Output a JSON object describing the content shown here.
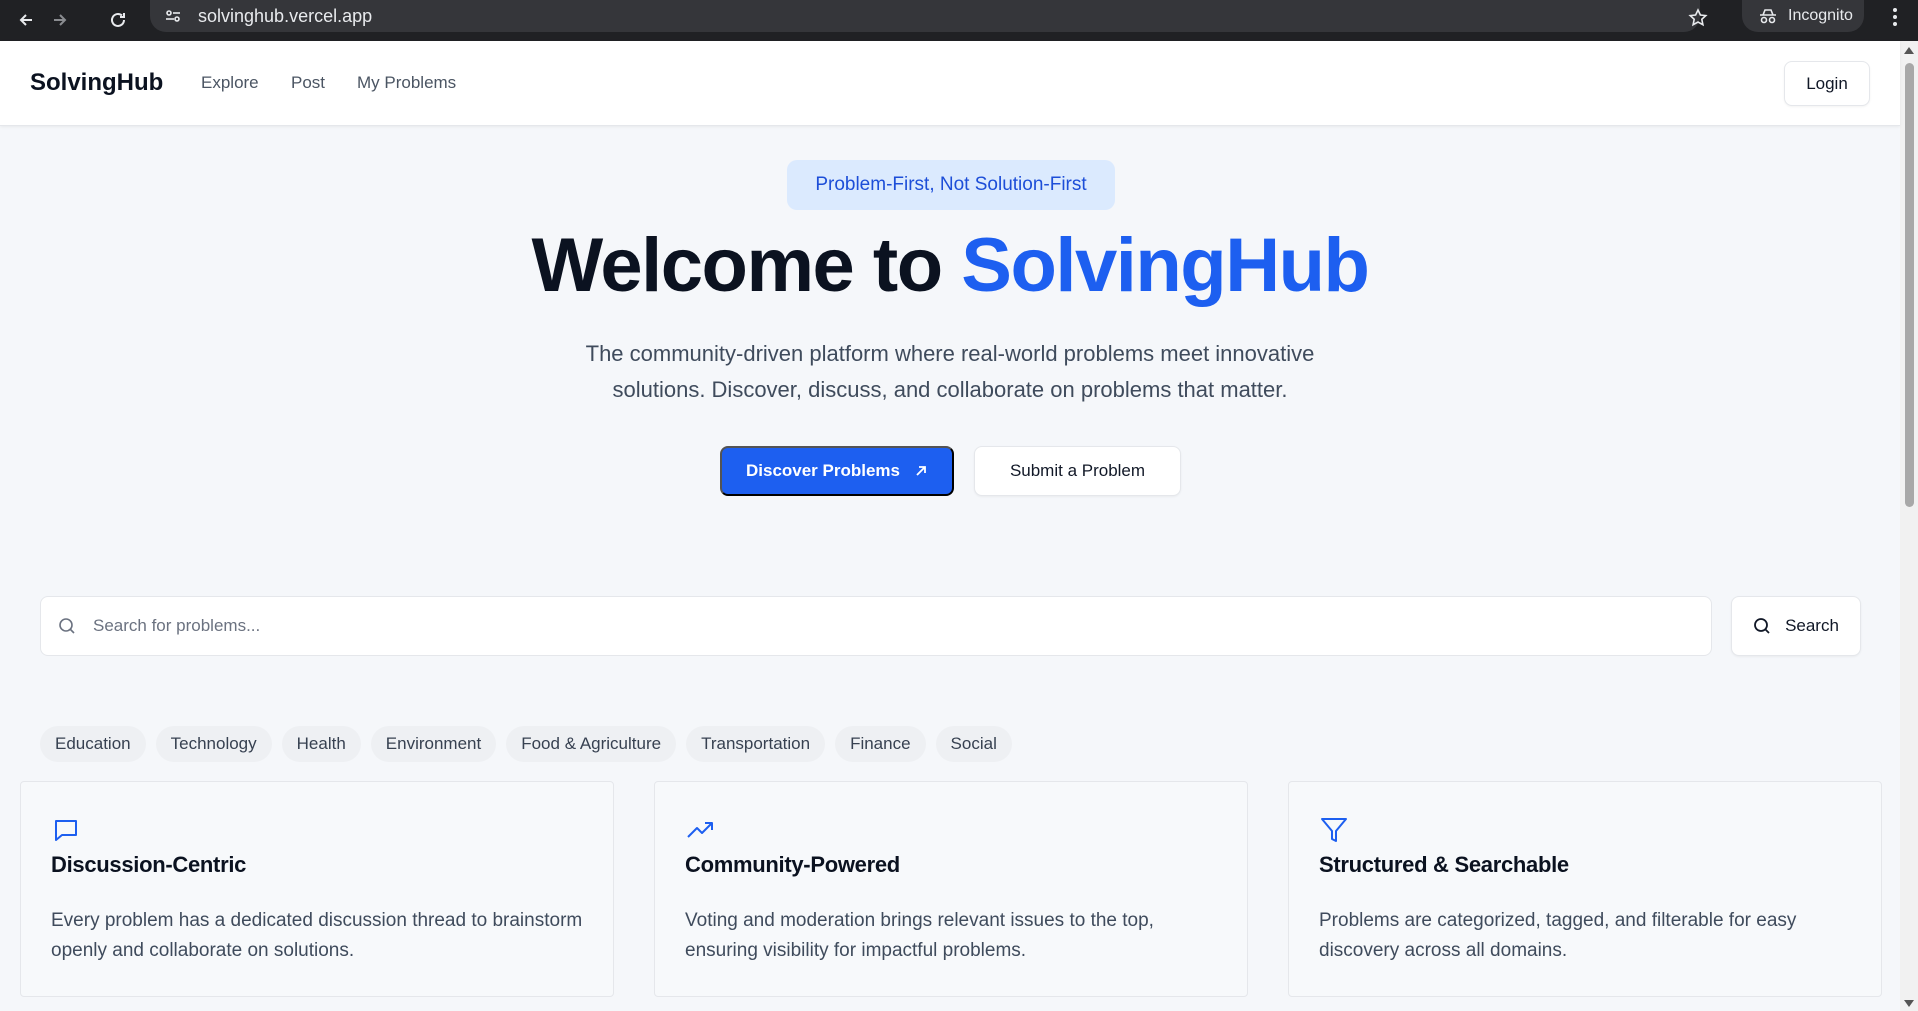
{
  "browser": {
    "url": "solvinghub.vercel.app",
    "profile_label": "Incognito"
  },
  "header": {
    "brand": "SolvingHub",
    "nav": [
      "Explore",
      "Post",
      "My Problems"
    ],
    "login_label": "Login"
  },
  "hero": {
    "tagline": "Problem-First, Not Solution-First",
    "title_prefix": "Welcome to ",
    "title_accent": "SolvingHub",
    "subtitle": "The community-driven platform where real-world problems meet innovative solutions. Discover, discuss, and collaborate on problems that matter.",
    "primary_label": "Discover Problems",
    "secondary_label": "Submit a Problem"
  },
  "search": {
    "placeholder": "Search for problems...",
    "button_label": "Search"
  },
  "categories": [
    "Education",
    "Technology",
    "Health",
    "Environment",
    "Food & Agriculture",
    "Transportation",
    "Finance",
    "Social"
  ],
  "features": [
    {
      "icon": "message-square-icon",
      "title": "Discussion-Centric",
      "description": "Every problem has a dedicated discussion thread to brainstorm openly and collaborate on solutions."
    },
    {
      "icon": "trending-up-icon",
      "title": "Community-Powered",
      "description": "Voting and moderation brings relevant issues to the top, ensuring visibility for impactful problems."
    },
    {
      "icon": "filter-icon",
      "title": "Structured & Searchable",
      "description": "Problems are categorized, tagged, and filterable for easy discovery across all domains."
    }
  ],
  "colors": {
    "accent": "#1d5ff0",
    "pill_bg": "#dbeafe",
    "pill_text": "#1d4ed8",
    "page_bg": "#f5f7fa"
  }
}
